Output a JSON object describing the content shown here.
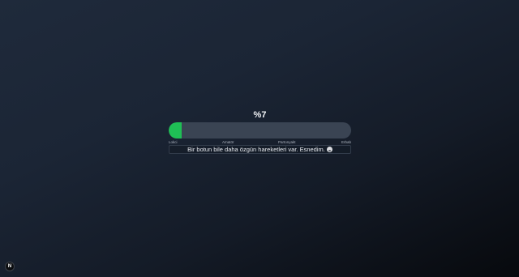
{
  "progress": {
    "percent_label": "%7",
    "value_percent": 7,
    "fill_color": "#1fbf55",
    "track_color": "#3a4453"
  },
  "scale": {
    "labels": [
      "Lokci",
      "Amatör",
      "Partonyakt",
      "Erbab"
    ]
  },
  "message": {
    "text": "Bir botun bile daha özgün hareketleri var. Esnedim.",
    "emoji_icon": "yawning-face-icon"
  },
  "badge": {
    "letter": "N",
    "icon": "n-logo-icon"
  }
}
